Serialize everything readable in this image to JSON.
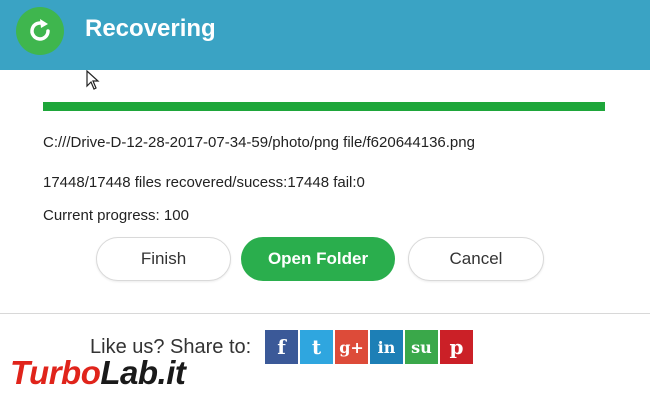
{
  "header": {
    "title": "Recovering",
    "color": "#3aa3c4",
    "logo_color": "#3fb64e"
  },
  "progress": {
    "percent": 100,
    "color": "#1ea63a"
  },
  "status": {
    "file_path": "C:///Drive-D-12-28-2017-07-34-59/photo/png file/f620644136.png",
    "files_recovered": "17448/17448 files recovered/sucess:17448 fail:0",
    "current_progress": "Current progress: 100"
  },
  "buttons": {
    "finish": "Finish",
    "open_folder": "Open Folder",
    "cancel": "Cancel"
  },
  "share": {
    "label": "Like us? Share to:",
    "networks": [
      {
        "icon": "facebook-icon",
        "glyph": "f",
        "color": "#3b5998"
      },
      {
        "icon": "twitter-icon",
        "glyph": "t",
        "color": "#2fa6df"
      },
      {
        "icon": "google-plus-icon",
        "glyph": "g+",
        "color": "#dd4b39"
      },
      {
        "icon": "linkedin-icon",
        "glyph": "in",
        "color": "#1d7fb6"
      },
      {
        "icon": "stumbleupon-icon",
        "glyph": "su",
        "color": "#3aa84a"
      },
      {
        "icon": "pinterest-icon",
        "glyph": "p",
        "color": "#cb2027"
      }
    ]
  },
  "watermark": {
    "part1": "Turbo",
    "part2": "Lab.it"
  }
}
